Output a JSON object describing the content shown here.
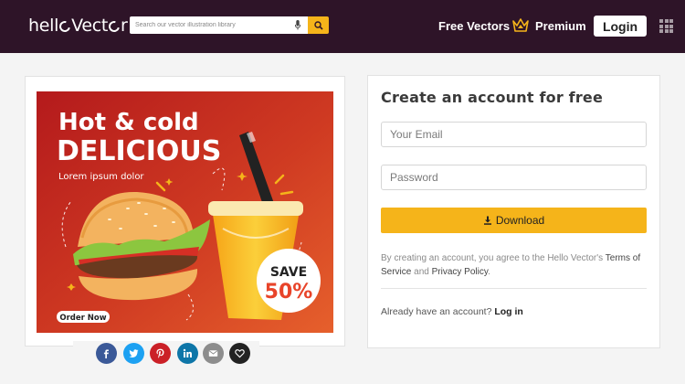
{
  "header": {
    "logo_part1": "hell",
    "logo_part2": "Vect",
    "logo_part3": "r",
    "search_placeholder": "Search our vector illustration library",
    "nav_free": "Free Vectors",
    "nav_premium": "Premium",
    "login_label": "Login"
  },
  "artwork": {
    "headline_line1": "Hot & cold",
    "headline_line2": "DELICIOUS",
    "tagline": "Lorem ipsum dolor",
    "badge_line1": "SAVE",
    "badge_line2": "50%",
    "order_label": "Order Now",
    "colors": {
      "background_top": "#e0582a",
      "background_bottom": "#b0181c",
      "badge_text": "#e8442a",
      "cup": "#f7b11d"
    }
  },
  "share": {
    "icons": [
      "facebook-icon",
      "twitter-icon",
      "pinterest-icon",
      "linkedin-icon",
      "email-icon",
      "heart-icon"
    ],
    "colors": [
      "#3b5998",
      "#1da1f2",
      "#cb2027",
      "#0e76a8",
      "#8d8d8d",
      "#222222"
    ]
  },
  "signup": {
    "title": "Create an account for free",
    "email_placeholder": "Your Email",
    "password_placeholder": "Password",
    "download_label": "Download",
    "terms_prefix": "By creating an account, you agree to the Hello Vector's ",
    "terms_link": "Terms of Service",
    "terms_and": " and ",
    "privacy_link": "Privacy Policy",
    "terms_suffix": ".",
    "signin_prompt": "Already have an account? ",
    "signin_link": "Log in"
  },
  "theme": {
    "header_bg": "#2e1428",
    "accent": "#f5b41a",
    "page_bg": "#f4f4f4"
  }
}
